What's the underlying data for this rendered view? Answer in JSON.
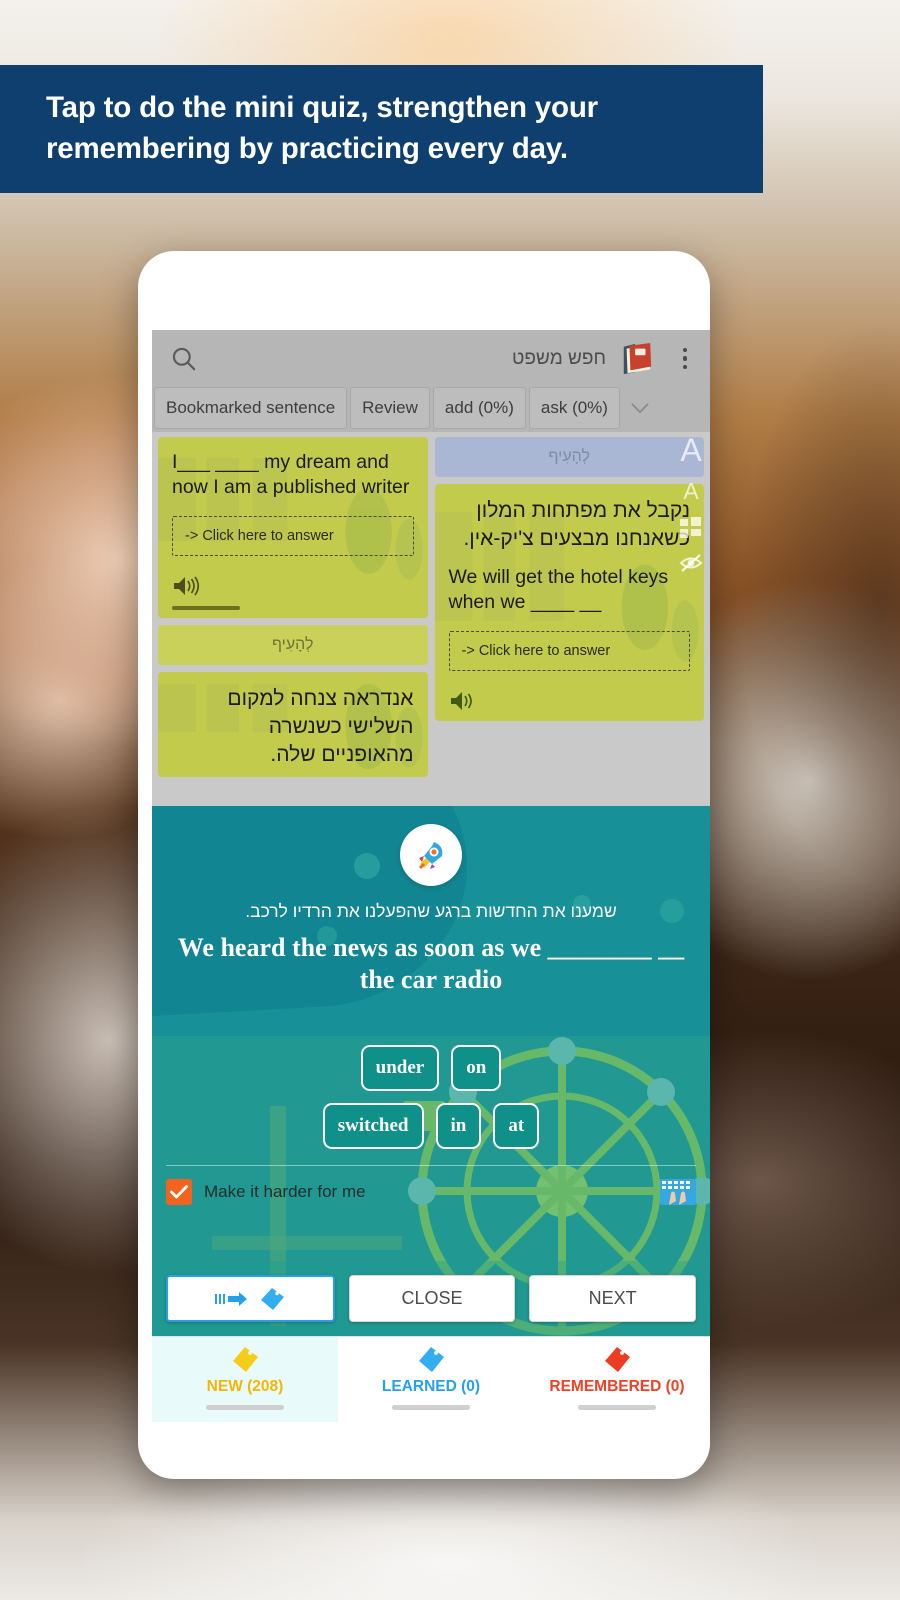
{
  "banner": {
    "text": "Tap to do the mini quiz, strengthen your remembering by practicing every day."
  },
  "app": {
    "header": {
      "search_placeholder": "חפש משפט",
      "search_icon": "search-icon",
      "book_icon": "book-icon",
      "overflow_icon": "three-dots-vertical-icon"
    },
    "tabs": [
      {
        "label": "Bookmarked sentence"
      },
      {
        "label": "Review"
      },
      {
        "label": "add (0%)"
      },
      {
        "label": "ask (0%)"
      }
    ],
    "tabs_more_icon": "chevron-down-icon",
    "edge_icons": [
      {
        "name": "font-size-large-icon",
        "glyph": "A"
      },
      {
        "name": "font-size-small-icon",
        "glyph": "A"
      },
      {
        "name": "grid-layout-icon",
        "glyph": ""
      },
      {
        "name": "hide-eye-icon",
        "glyph": ""
      }
    ],
    "cards": {
      "left": [
        {
          "sentence_en": "I___ ____ my dream and now I am a published writer",
          "answer_hint": "-> Click here to answer",
          "speaker_icon": "speaker-icon"
        },
        {
          "skip_label": "לְהָעִיף"
        },
        {
          "sentence_he": "אנדראה צנחה למקום השלישי כשנשרה מהאופניים שלה."
        }
      ],
      "right": [
        {
          "skip_label": "לְהָעִיף"
        },
        {
          "sentence_he": "נקבל את מפתחות המלון כשאנחנו מבצעים צ'יק-אין.",
          "sentence_en": "We will get the hotel keys when we ____ __",
          "answer_hint": "-> Click here to answer",
          "speaker_icon": "speaker-icon"
        }
      ]
    },
    "quiz": {
      "badge_icon": "rocket-icon",
      "prompt_he": "שמענו את החדשות ברגע שהפעלנו את הרדיו לרכב.",
      "prompt_en": "We heard the news as soon as we ________ __ the car radio",
      "options_row1": [
        "under",
        "on"
      ],
      "options_row2": [
        "switched",
        "in",
        "at"
      ],
      "harder_label": "Make it harder for me",
      "harder_checked": true,
      "keyboard_icon": "keyboard-icon",
      "buttons": {
        "tag_label": "",
        "tag_icon": "arrow-tag-icon",
        "close_label": "CLOSE",
        "next_label": "NEXT"
      }
    },
    "bottom_nav": [
      {
        "label": "NEW (208)",
        "icon": "tag-icon-yellow",
        "color": "#f2b705",
        "tag_color": "#f5cd18",
        "active": true
      },
      {
        "label": "LEARNED (0)",
        "icon": "tag-icon-blue",
        "color": "#27a0ec",
        "tag_color": "#30aef0",
        "active": false
      },
      {
        "label": "REMEMBERED (0)",
        "icon": "tag-icon-red",
        "color": "#ef4123",
        "tag_color": "#ee3c24",
        "active": false
      }
    ]
  },
  "colors": {
    "banner_bg": "#0e3f6e",
    "quiz_bg": "#179098",
    "card_green": "#c3cb4d",
    "accent_orange": "#f4631e",
    "accent_blue": "#27a0ec"
  }
}
